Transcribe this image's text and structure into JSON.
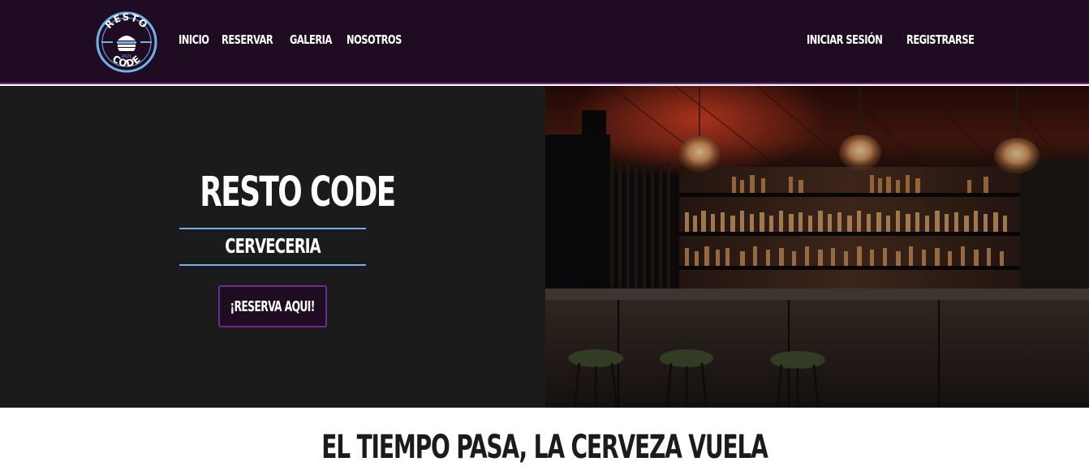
{
  "brand": {
    "logo_top": "RESTO",
    "logo_bottom": "CODE",
    "logo_year": "2021"
  },
  "nav": {
    "left": [
      "INICIO",
      "RESERVAR",
      "GALERIA",
      "NOSOTROS"
    ],
    "right": [
      "INICIAR SESIÓN",
      "REGISTRARSE"
    ]
  },
  "hero": {
    "title": "RESTO CODE",
    "subtitle": "CERVECERIA",
    "cta": "¡RESERVA AQUI!"
  },
  "tagline": "EL TIEMPO PASA, LA CERVEZA VUELA",
  "colors": {
    "navbar_bg": "#1f0c23",
    "accent_purple": "#6b2d8a",
    "accent_blue": "#6fb1e8",
    "hero_bg": "#1b1b1b"
  }
}
